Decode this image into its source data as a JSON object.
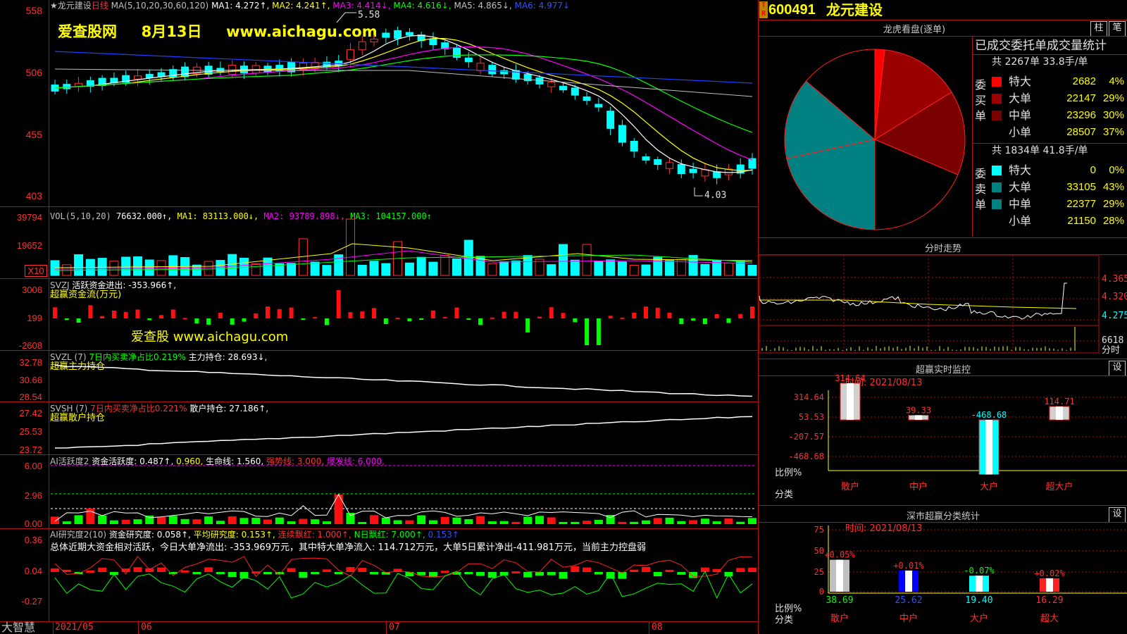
{
  "stock": {
    "code": "600491",
    "name": "龙元建设",
    "tag": "T R"
  },
  "main_header": {
    "star_name": "★龙元建设",
    "period": "日线",
    "ma_label": "MA(5,10,20,30,60,120)",
    "ma1": "MA1: 4.272↑,",
    "ma2": "MA2: 4.241↑,",
    "ma3": "MA3: 4.414↓,",
    "ma4": "MA4: 4.616↓,",
    "ma5": "MA5: 4.865↓,",
    "ma6": "MA6: 4.977↓"
  },
  "watermark": {
    "site": "爱查股网",
    "date": "8月13日",
    "url": "www.aichagu.com",
    "svzj_mark": "爱查股 www.aichagu.com"
  },
  "price_annotations": {
    "high": "5.58",
    "low": "4.03"
  },
  "yaxis": {
    "price": [
      "558",
      "506",
      "455",
      "403"
    ],
    "vol": [
      "39794",
      "19652",
      "X10"
    ],
    "svzj": [
      "3006",
      "199",
      "-2608"
    ],
    "svzl": [
      "32.78",
      "30.66",
      "28.54"
    ],
    "svsh": [
      "27.42",
      "25.53",
      "23.72"
    ],
    "ai1": [
      "6.00",
      "2.96",
      "0.00"
    ],
    "ai2": [
      "0.36",
      "0.04",
      "-0.27"
    ]
  },
  "vol_header": {
    "label": "VOL(5,10,20)",
    "value": "76632.000↑,",
    "ma1": "MA1: 83113.000↓,",
    "ma2": "MA2: 93789.898↓,",
    "ma3": "MA3: 104157.000↑"
  },
  "svzj_header": {
    "label": "SVZJ",
    "title": "活跃资金进出: -353.966↑,",
    "sub": "超赢资金流(万元)"
  },
  "svzl_header": {
    "label": "SVZL (7)",
    "pct": "7日内买卖净占比0.219%",
    "hold": "主力持仓: 28.693↓,",
    "sub": "超赢主力持仓"
  },
  "svsh_header": {
    "label": "SVSH (7)",
    "pct": "7日内买卖净占比0.221%",
    "hold": "散户持仓: 27.186↑,",
    "sub": "超赢散户持仓"
  },
  "ai1_header": {
    "label": "AI活跃度2",
    "a": "资金活跃度: 0.487↑,",
    "b": "0.960,",
    "c": "生命线: 1.560,",
    "d": "强势线: 3.000,",
    "e": "爆发线: 6.000,"
  },
  "ai2_header": {
    "label": "AI研究度2(10)",
    "a": "资金研究度: 0.058↑,",
    "b": "平均研究度: 0.153↑,",
    "c": "连续飘红: 1.000↑,",
    "d": "N日飘红: 7.000↑,",
    "e": "0.153↑",
    "summary": "总体近期大资金相对活跃，今日大单净流出: -353.969万元，其中特大单净流入: 114.712万元，大单5日累计净出-411.981万元，当前主力控盘弱"
  },
  "xaxis": {
    "brand": "大智慧",
    "labels": [
      "2021/05",
      "06",
      "07",
      "08"
    ]
  },
  "lhb": {
    "title": "龙虎看盘(逐单)",
    "btn1": "柱",
    "btn2": "笔",
    "stats_title": "已成交委托单成交量统计",
    "buy_label": "委买单",
    "sell_label": "委卖单",
    "buy_total": "共 2267单 33.8手/单",
    "sell_total": "共 1834单 41.8手/单",
    "buy_rows": [
      {
        "name": "特大",
        "vol": "2682",
        "pct": "4%",
        "color": "#ff0000"
      },
      {
        "name": "大单",
        "vol": "22147",
        "pct": "29%",
        "color": "#9a0000"
      },
      {
        "name": "中单",
        "vol": "23296",
        "pct": "30%",
        "color": "#7a0000"
      },
      {
        "name": "小单",
        "vol": "28507",
        "pct": "37%",
        "color": "#000000"
      }
    ],
    "sell_rows": [
      {
        "name": "特大",
        "vol": "0",
        "pct": "0%",
        "color": "#00ffff"
      },
      {
        "name": "大单",
        "vol": "33105",
        "pct": "43%",
        "color": "#008080"
      },
      {
        "name": "中单",
        "vol": "22377",
        "pct": "29%",
        "color": "#008080"
      },
      {
        "name": "小单",
        "vol": "21150",
        "pct": "28%",
        "color": "#000000"
      }
    ]
  },
  "intraday": {
    "title": "分时走势",
    "y": [
      "4.365",
      "4.320",
      "4.275"
    ],
    "vol": "6618",
    "vol_unit": "分时"
  },
  "monitor": {
    "title": "超赢实时监控",
    "btn": "设",
    "time": "时间: 2021/08/13",
    "y": [
      "314.64",
      "53.53",
      "-207.57",
      "-468.68"
    ],
    "ratio": "比例%",
    "cat": "分类",
    "values": [
      "314.64",
      "39.33",
      "-468.68",
      "114.71"
    ],
    "cats": [
      "散户",
      "中户",
      "大户",
      "超大户"
    ]
  },
  "shenzhen": {
    "title": "深市超赢分类统计",
    "btn": "设",
    "time": "时间: 2021/08/13",
    "y": [
      "75",
      "50",
      "25",
      "0"
    ],
    "ratio": "比例%",
    "cat": "分类",
    "deltas": [
      "+0.05%",
      "+0.01%",
      "-0.07%",
      "+0.02%"
    ],
    "values": [
      "38.69",
      "25.62",
      "19.40",
      "16.29"
    ],
    "cats": [
      "散户",
      "中户",
      "大户",
      "超大"
    ]
  },
  "chart_data": [
    {
      "type": "candlestick",
      "title": "龙元建设 日线",
      "ylim": [
        4.03,
        5.58
      ],
      "y_ticks": [
        "558",
        "506",
        "455",
        "403"
      ],
      "high_label": "5.58",
      "low_label": "4.03",
      "x": [
        "2021/05",
        "06",
        "07",
        "08"
      ],
      "series": [
        {
          "name": "MA1",
          "value": 4.272
        },
        {
          "name": "MA2",
          "value": 4.241
        },
        {
          "name": "MA3",
          "value": 4.414
        },
        {
          "name": "MA4",
          "value": 4.616
        },
        {
          "name": "MA5",
          "value": 4.865
        },
        {
          "name": "MA6",
          "value": 4.977
        }
      ]
    },
    {
      "type": "bar",
      "title": "VOL(5,10,20)",
      "value": 76632.0,
      "ma": [
        83113.0,
        93789.898,
        104157.0
      ],
      "ylim_label": [
        "39794",
        "19652"
      ]
    },
    {
      "type": "bar",
      "title": "超赢资金流(万元)",
      "value": -353.966
    },
    {
      "type": "pie",
      "title": "龙虎看盘(逐单)",
      "labels": [
        "买特大",
        "买大单",
        "买中单",
        "买小单",
        "卖特大",
        "卖大单",
        "卖中单",
        "卖小单"
      ],
      "values": [
        2682,
        22147,
        23296,
        28507,
        0,
        33105,
        22377,
        21150
      ]
    },
    {
      "type": "bar",
      "title": "超赢实时监控",
      "categories": [
        "散户",
        "中户",
        "大户",
        "超大户"
      ],
      "values": [
        314.64,
        39.33,
        -468.68,
        114.71
      ]
    },
    {
      "type": "bar",
      "title": "深市超赢分类统计",
      "categories": [
        "散户",
        "中户",
        "大户",
        "超大"
      ],
      "values": [
        38.69,
        25.62,
        19.4,
        16.29
      ],
      "deltas": [
        "+0.05%",
        "+0.01%",
        "-0.07%",
        "+0.02%"
      ]
    }
  ]
}
